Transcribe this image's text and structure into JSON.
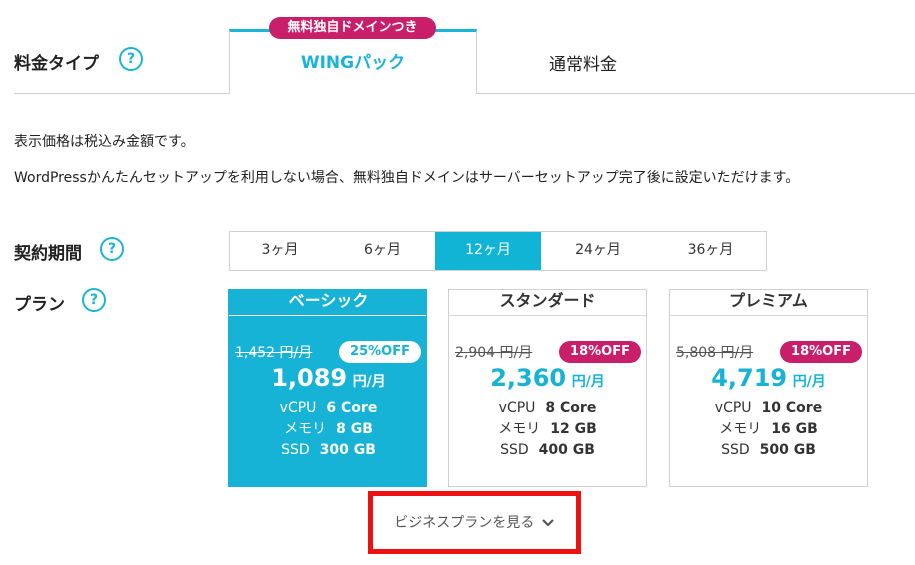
{
  "price_type": {
    "label": "料金タイプ",
    "help_glyph": "?",
    "tabs": [
      {
        "label": "WINGパック",
        "ribbon": "無料独自ドメインつき",
        "active": true
      },
      {
        "label": "通常料金",
        "active": false
      }
    ]
  },
  "notes": {
    "tax": "表示価格は税込み金額です。",
    "wordpress": "WordPressかんたんセットアップを利用しない場合、無料独自ドメインはサーバーセットアップ完了後に設定いただけます。"
  },
  "contract": {
    "label": "契約期間",
    "help_glyph": "?",
    "options": [
      "3ヶ月",
      "6ヶ月",
      "12ヶ月",
      "24ヶ月",
      "36ヶ月"
    ],
    "selected": "12ヶ月"
  },
  "plan": {
    "label": "プラン",
    "help_glyph": "?",
    "cards": [
      {
        "name": "ベーシック",
        "old_price": "1,452 円/月",
        "discount": "25%OFF",
        "price": "1,089",
        "unit": "円/月",
        "specs": [
          {
            "k": "vCPU",
            "v": "6 Core"
          },
          {
            "k": "メモリ",
            "v": "8 GB"
          },
          {
            "k": "SSD",
            "v": "300 GB"
          }
        ],
        "active": true
      },
      {
        "name": "スタンダード",
        "old_price": "2,904 円/月",
        "discount": "18%OFF",
        "price": "2,360",
        "unit": "円/月",
        "specs": [
          {
            "k": "vCPU",
            "v": "8 Core"
          },
          {
            "k": "メモリ",
            "v": "12 GB"
          },
          {
            "k": "SSD",
            "v": "400 GB"
          }
        ],
        "active": false
      },
      {
        "name": "プレミアム",
        "old_price": "5,808 円/月",
        "discount": "18%OFF",
        "price": "4,719",
        "unit": "円/月",
        "specs": [
          {
            "k": "vCPU",
            "v": "10 Core"
          },
          {
            "k": "メモリ",
            "v": "16 GB"
          },
          {
            "k": "SSD",
            "v": "500 GB"
          }
        ],
        "active": false
      }
    ]
  },
  "business_link": {
    "label": "ビジネスプランを見る",
    "icon": "chevron-down-icon"
  },
  "colors": {
    "accent": "#17b3d6",
    "badge": "#c91f6b",
    "highlight": "#ee1111"
  }
}
